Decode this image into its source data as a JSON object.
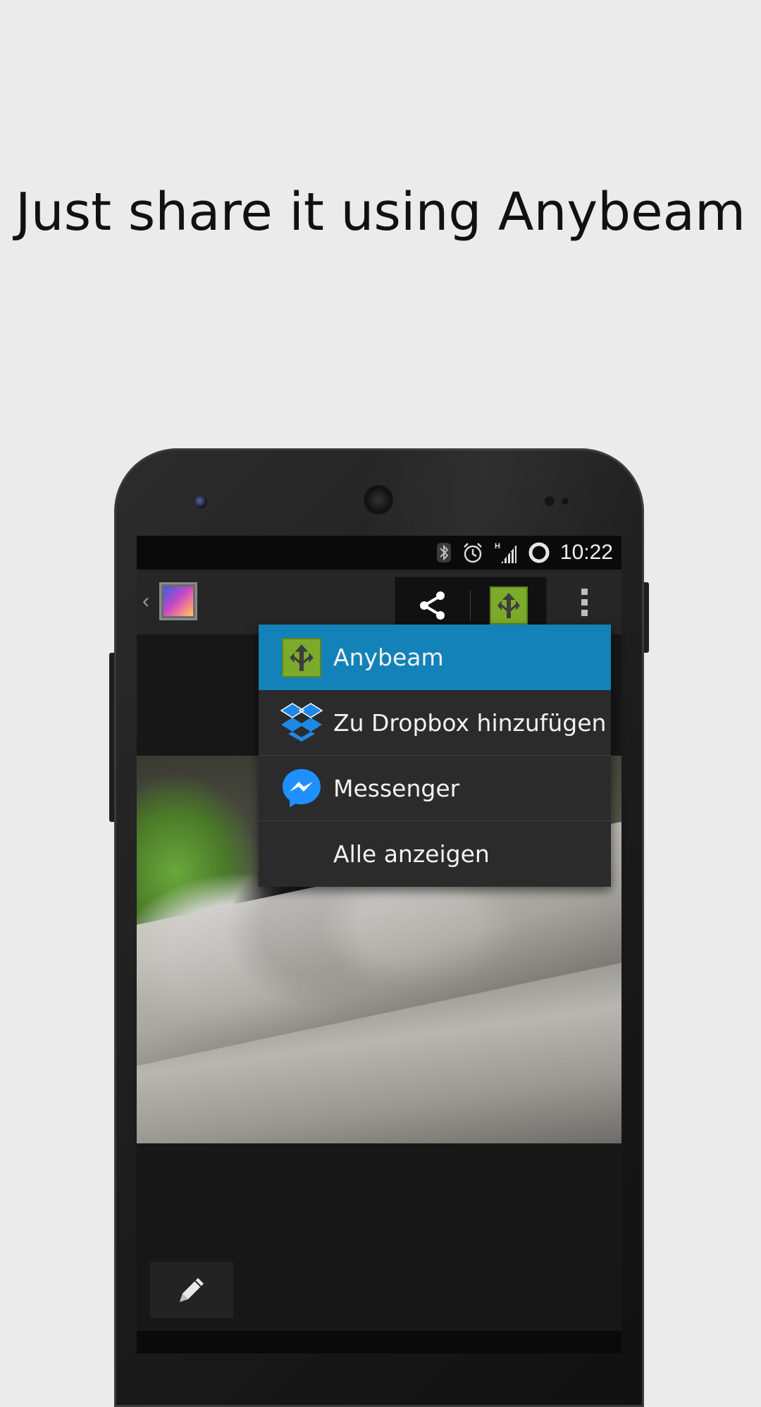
{
  "headline": "Just share it using Anybeam",
  "status_bar": {
    "time": "10:22",
    "icons": [
      "bluetooth-icon",
      "alarm-icon",
      "signal-h-icon",
      "battery-ring-icon"
    ]
  },
  "action_bar": {
    "back_icon": "chevron-left-icon",
    "app_icon": "gallery-icon",
    "actions": [
      "share-icon",
      "anybeam-icon",
      "overflow-menu-icon"
    ]
  },
  "share_menu": {
    "items": [
      {
        "label": "Anybeam",
        "icon": "anybeam-icon",
        "selected": true
      },
      {
        "label": "Zu Dropbox hinzufügen",
        "icon": "dropbox-icon",
        "selected": false
      },
      {
        "label": "Messenger",
        "icon": "messenger-icon",
        "selected": false
      },
      {
        "label": "Alle anzeigen",
        "icon": "",
        "selected": false
      }
    ]
  },
  "edit_button_icon": "pencil-icon",
  "colors": {
    "background": "#ebebeb",
    "menu_highlight": "#1282b8",
    "menu_background": "#2b2b2b",
    "anybeam_green": "#7cab2b",
    "dropbox_blue": "#1e88e5",
    "messenger_blue": "#1e90ff"
  }
}
